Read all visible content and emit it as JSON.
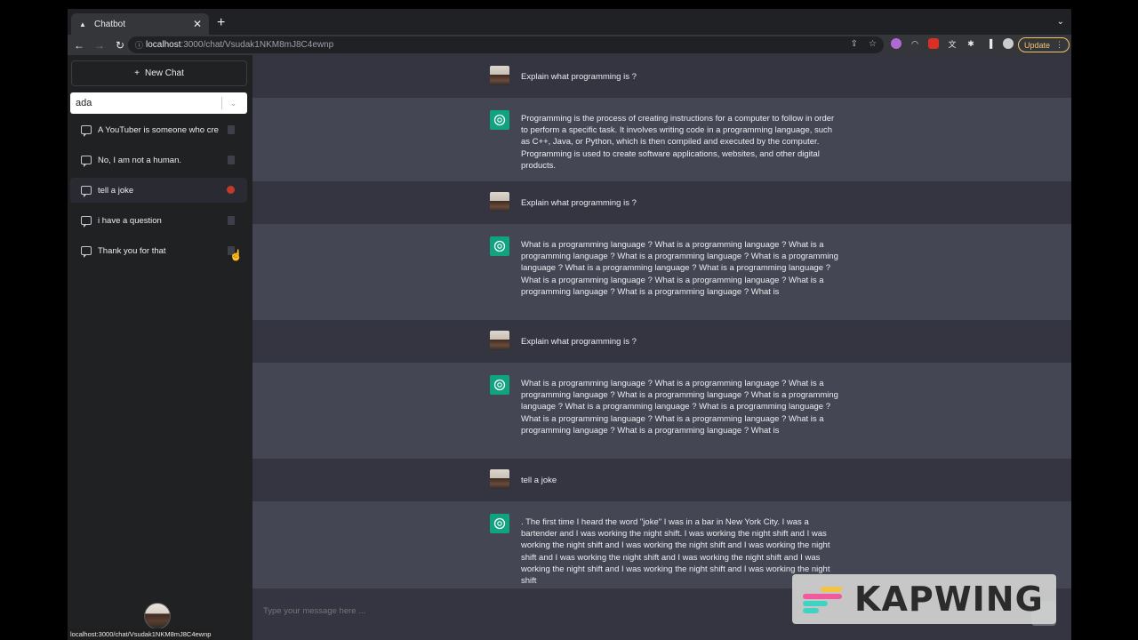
{
  "browser": {
    "tab_title": "Chatbot",
    "url_host": "localhost",
    "url_path": ":3000/chat/Vsudak1NKM8mJ8C4ewnp",
    "update_label": "Update",
    "status_url": "localhost:3000/chat/Vsudak1NKM8mJ8C4ewnp"
  },
  "sidebar": {
    "new_chat_label": "New Chat",
    "search_value": "ada",
    "conversations": [
      {
        "label": "A YouTuber is someone who cre"
      },
      {
        "label": "No, I am not a human."
      },
      {
        "label": "tell a joke"
      },
      {
        "label": "i have a question"
      },
      {
        "label": "Thank you for that"
      }
    ]
  },
  "messages": [
    {
      "role": "user",
      "text": "Explain what programming is ?"
    },
    {
      "role": "bot",
      "text": "Programming is the process of creating instructions for a computer to follow in order to perform a specific task. It involves writing code in a programming language, such as C++, Java, or Python, which is then compiled and executed by the computer. Programming is used to create software applications, websites, and other digital products."
    },
    {
      "role": "user",
      "text": "Explain what programming is ?"
    },
    {
      "role": "bot",
      "text": "What is a programming language ? What is a programming language ? What is a programming language ? What is a programming language ? What is a programming language ? What is a programming language ? What is a programming language ? What is a programming language ? What is a programming language ? What is a programming language ? What is a programming language ? What is"
    },
    {
      "role": "user",
      "text": "Explain what programming is ?"
    },
    {
      "role": "bot",
      "text": "What is a programming language ? What is a programming language ? What is a programming language ? What is a programming language ? What is a programming language ? What is a programming language ? What is a programming language ? What is a programming language ? What is a programming language ? What is a programming language ? What is a programming language ? What is"
    },
    {
      "role": "user",
      "text": "tell a joke"
    },
    {
      "role": "bot",
      "text": ". The first time I heard the word \"joke\" I was in a bar in New York City. I was a bartender and I was working the night shift. I was working the night shift and I was working the night shift and I was working the night shift and I was working the night shift and I was working the night shift and I was working the night shift and I was working the night shift and I was working the night shift and I was working the night shift"
    }
  ],
  "input": {
    "placeholder": "Type your message here ..."
  },
  "watermark": {
    "text": "KAPWING"
  }
}
